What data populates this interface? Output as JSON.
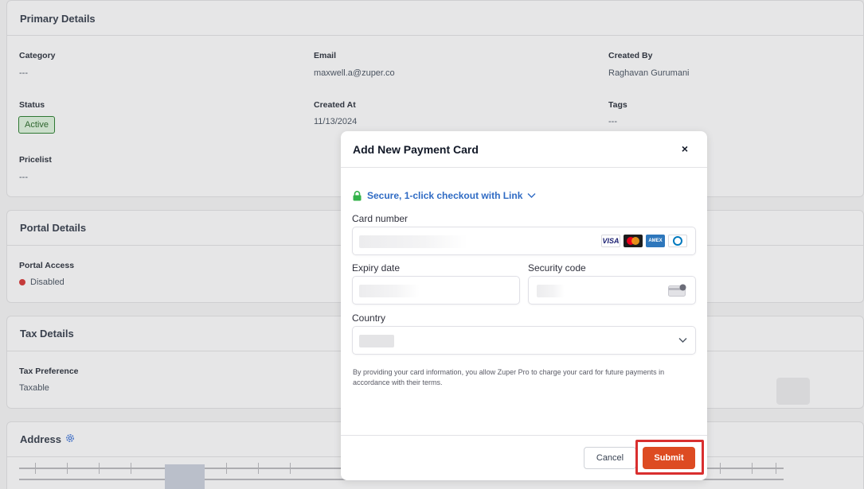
{
  "primary": {
    "title": "Primary Details",
    "category_label": "Category",
    "category_value": "---",
    "email_label": "Email",
    "email_value": "maxwell.a@zuper.co",
    "created_by_label": "Created By",
    "created_by_value": "Raghavan Gurumani",
    "status_label": "Status",
    "status_value": "Active",
    "created_at_label": "Created At",
    "created_at_value": "11/13/2024",
    "tags_label": "Tags",
    "tags_value": "---",
    "pricelist_label": "Pricelist",
    "pricelist_value": "---"
  },
  "portal": {
    "title": "Portal Details",
    "access_label": "Portal Access",
    "access_value": "Disabled"
  },
  "tax": {
    "title": "Tax Details",
    "preference_label": "Tax Preference",
    "preference_value": "Taxable"
  },
  "address": {
    "title": "Address",
    "icon": "gear-icon"
  },
  "modal": {
    "title": "Add New Payment Card",
    "close_label": "×",
    "link_text": "Secure, 1-click checkout with Link",
    "card_number_label": "Card number",
    "expiry_label": "Expiry date",
    "security_label": "Security code",
    "country_label": "Country",
    "brands": [
      "VISA",
      "Mastercard",
      "AMEX",
      "Diners"
    ],
    "terms": "By providing your card information, you allow Zuper Pro to charge your card for future payments in accordance with their terms.",
    "cancel_label": "Cancel",
    "submit_label": "Submit"
  },
  "colors": {
    "accent": "#dd4b22",
    "link": "#2f6bc4",
    "highlight": "#d92f2f",
    "status_active": "#2e7d32",
    "status_disabled": "#d03a3a"
  }
}
